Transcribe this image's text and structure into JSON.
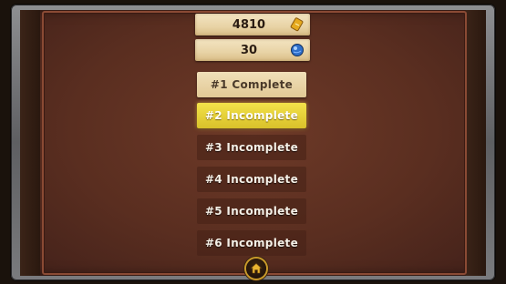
{
  "counters": {
    "coins": {
      "value": "4810",
      "icon": "gold-ticket-icon"
    },
    "gems": {
      "value": "30",
      "icon": "blue-orb-icon"
    }
  },
  "levels": [
    {
      "label": "#1 Complete",
      "state": "complete"
    },
    {
      "label": "#2 Incomplete",
      "state": "current"
    },
    {
      "label": "#3 Incomplete",
      "state": "locked"
    },
    {
      "label": "#4 Incomplete",
      "state": "locked"
    },
    {
      "label": "#5 Incomplete",
      "state": "locked"
    },
    {
      "label": "#6 Incomplete",
      "state": "locked"
    }
  ],
  "home_button": {
    "icon": "home-icon"
  },
  "colors": {
    "board": "#5a2e20",
    "plank": "#e8d3a5",
    "selected": "#e6cf35",
    "gold": "#c99a2a"
  }
}
